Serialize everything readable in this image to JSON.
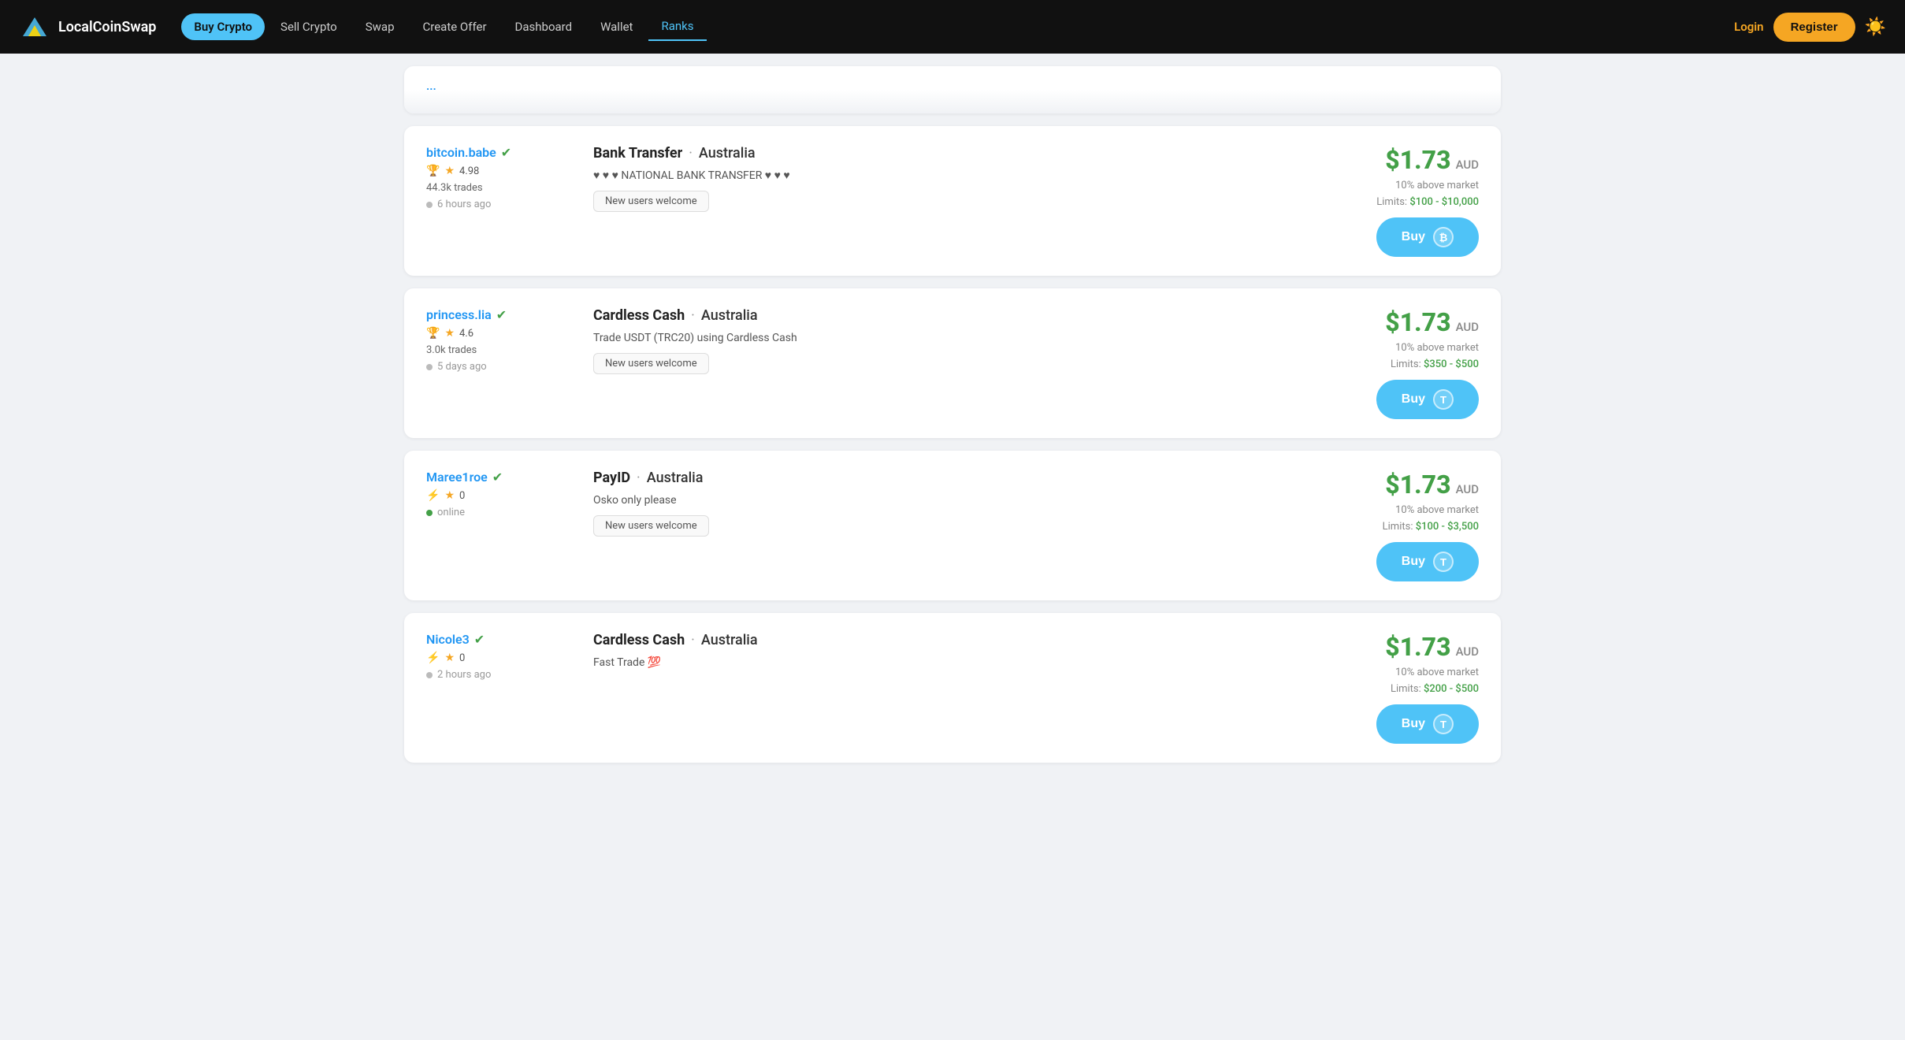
{
  "nav": {
    "logo_text": "LocalCoinSwap",
    "links": [
      {
        "label": "Buy Crypto",
        "active": "pill"
      },
      {
        "label": "Sell Crypto",
        "active": "none"
      },
      {
        "label": "Swap",
        "active": "none"
      },
      {
        "label": "Create Offer",
        "active": "none"
      },
      {
        "label": "Dashboard",
        "active": "none"
      },
      {
        "label": "Wallet",
        "active": "none"
      },
      {
        "label": "Ranks",
        "active": "underline"
      }
    ],
    "login_label": "Login",
    "register_label": "Register",
    "sun_icon": "☀️"
  },
  "offers": [
    {
      "seller_name": "bitcoin.babe",
      "verified": true,
      "trophy": true,
      "rating": "4.98",
      "trades": "44.3k trades",
      "time": "6 hours ago",
      "online": false,
      "method": "Bank Transfer",
      "country": "Australia",
      "description": "♥ ♥ ♥ NATIONAL BANK TRANSFER ♥ ♥ ♥",
      "tag": "New users welcome",
      "price": "$1.73",
      "currency": "AUD",
      "above_market": "10% above market",
      "limits": "$100 - $10,000",
      "coin_symbol": "₿",
      "coin_type": "bitcoin"
    },
    {
      "seller_name": "princess.lia",
      "verified": true,
      "trophy": true,
      "rating": "4.6",
      "trades": "3.0k trades",
      "time": "5 days ago",
      "online": false,
      "method": "Cardless Cash",
      "country": "Australia",
      "description": "Trade USDT (TRC20) using Cardless Cash",
      "tag": "New users welcome",
      "price": "$1.73",
      "currency": "AUD",
      "above_market": "10% above market",
      "limits": "$350 - $500",
      "coin_symbol": "T",
      "coin_type": "tether"
    },
    {
      "seller_name": "Maree1roe",
      "verified": true,
      "trophy": false,
      "rating": "0",
      "trades": "",
      "time": "online",
      "online": true,
      "method": "PayID",
      "country": "Australia",
      "description": "Osko only please",
      "tag": "New users welcome",
      "price": "$1.73",
      "currency": "AUD",
      "above_market": "10% above market",
      "limits": "$100 - $3,500",
      "coin_symbol": "T",
      "coin_type": "tether"
    },
    {
      "seller_name": "Nicole3",
      "verified": true,
      "trophy": false,
      "rating": "0",
      "trades": "",
      "time": "2 hours ago",
      "online": false,
      "method": "Cardless Cash",
      "country": "Australia",
      "description": "Fast Trade 💯",
      "tag": "",
      "price": "$1.73",
      "currency": "AUD",
      "above_market": "10% above market",
      "limits": "$200 - $500",
      "coin_symbol": "T",
      "coin_type": "tether"
    }
  ],
  "buy_label": "Buy"
}
